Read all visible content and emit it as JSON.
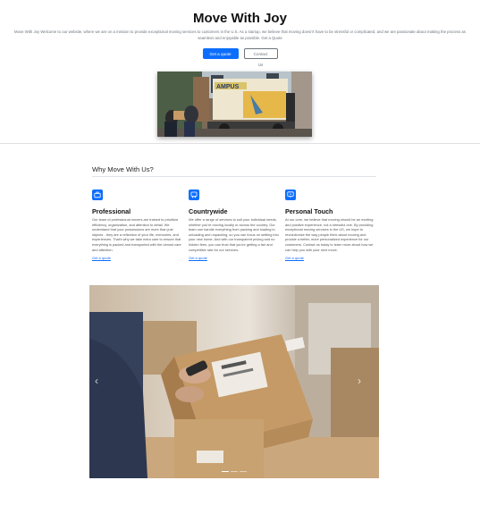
{
  "hero": {
    "title": "Move With Joy",
    "lead": "Move With Joy Welcome to our website, where we are on a mission to provide exceptional moving services to customers in the U.S. As a startup, we believe that moving doesn't have to be stressful or complicated, and we are passionate about making the process as seamless and enjoyable as possible. Get a Quote",
    "primary_button": "Get a quote",
    "secondary_button": "Contact Us",
    "image_truck_text": "AMPUS"
  },
  "why": {
    "title": "Why Move With Us?",
    "features": [
      {
        "icon": "briefcase-icon",
        "title": "Professional",
        "text": "Our team of professional movers are trained to prioritize efficiency, organization, and attention to detail. We understand that your possessions are more than just objects - they are a reflection of your life, memories, and experiences. That's why we take extra care to ensure that everything is packed and transported with the utmost care and attention.",
        "link": "Get a quote"
      },
      {
        "icon": "truck-icon",
        "title": "Countrywide",
        "text": "We offer a range of services to suit your individual needs, whether you're moving locally or across the country. Our team can handle everything from packing and loading to unloading and unpacking, so you can focus on settling into your new home. And with our transparent pricing and no hidden fees, you can trust that you're getting a fair and competitive rate for our services.",
        "link": "Get a quote"
      },
      {
        "icon": "chat-icon",
        "title": "Personal Touch",
        "text": "At our core, we believe that moving should be an exciting and positive experience, not a stressful one. By providing exceptional moving services in the US, we hope to revolutionize the way people think about moving and provide a better, more personalized experience for our customers. Contact us today to learn more about how we can help you with your next move.",
        "link": "Get a quote"
      }
    ]
  },
  "carousel": {
    "prev": "‹",
    "next": "›",
    "slide_count": 3,
    "active_index": 0
  },
  "colors": {
    "accent": "#0d6efd"
  }
}
